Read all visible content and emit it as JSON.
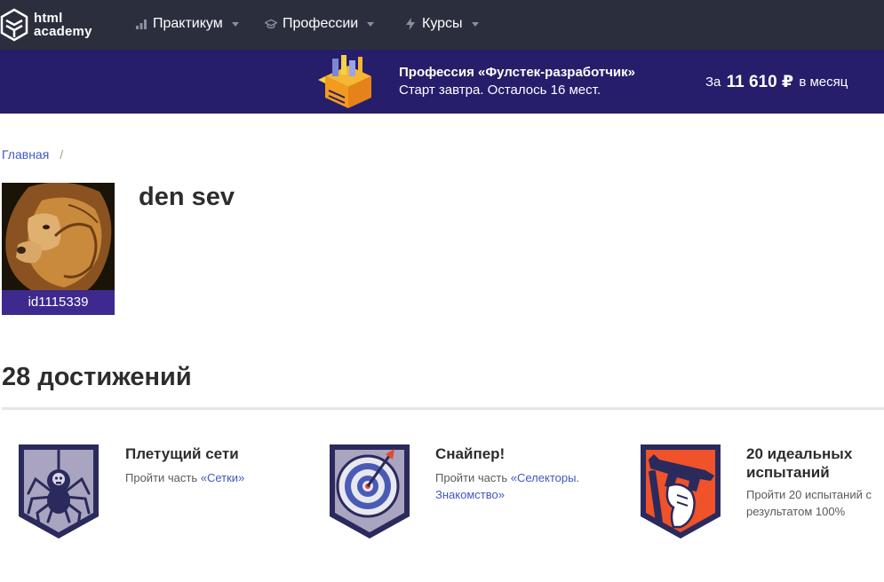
{
  "logo": {
    "line1": "html",
    "line2": "academy"
  },
  "nav": [
    {
      "label": "Практикум",
      "icon": "chart-bars-icon"
    },
    {
      "label": "Профессии",
      "icon": "graduation-cap-icon"
    },
    {
      "label": "Курсы",
      "icon": "lightning-icon"
    }
  ],
  "banner": {
    "title": "Профессия «Фулстек-разработчик»",
    "subtitle": "Старт завтра. Осталось 16 мест.",
    "price_prefix": "За",
    "price_value": "11 610 ₽",
    "price_suffix": "в месяц"
  },
  "breadcrumb": {
    "home": "Главная",
    "separator": "/"
  },
  "profile": {
    "name": "den sev",
    "id": "id1115339"
  },
  "achievements": {
    "heading": "28 достижений",
    "items": [
      {
        "title": "Плетущий сети",
        "desc_prefix": "Пройти часть ",
        "link": "«Сетки»",
        "icon": "spider-badge-icon"
      },
      {
        "title": "Снайпер!",
        "desc_prefix": "Пройти часть ",
        "link": "«Селекторы. Знакомство»",
        "icon": "target-badge-icon"
      },
      {
        "title": "20 идеальных испытаний",
        "desc_prefix": "Пройти 20 испытаний с результатом 100%",
        "link": "",
        "icon": "gun-badge-icon"
      }
    ]
  },
  "colors": {
    "nav_bg": "#2b2f3d",
    "banner_bg": "#261d6b",
    "link": "#3f58c4",
    "avatar_id_bg": "#3e2a8e",
    "badge_border": "#2b2a5c"
  }
}
